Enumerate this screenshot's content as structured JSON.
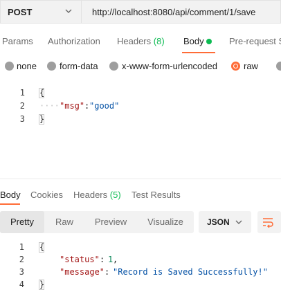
{
  "request": {
    "method": "POST",
    "url": "http://localhost:8080/api/comment/1/save"
  },
  "request_tabs": {
    "params": "Params",
    "authorization": "Authorization",
    "headers_label": "Headers",
    "headers_count": "(8)",
    "body": "Body",
    "pre_request": "Pre-request S"
  },
  "body_types": {
    "none": "none",
    "form_data": "form-data",
    "urlencoded": "x-www-form-urlencoded",
    "raw": "raw",
    "selected": "raw"
  },
  "request_body": {
    "line_numbers": [
      "1",
      "2",
      "3"
    ],
    "open_brace": "{",
    "key": "\"msg\"",
    "colon": ":",
    "value": "\"good\"",
    "close_brace": "}"
  },
  "response_tabs": {
    "body": "Body",
    "cookies": "Cookies",
    "headers_label": "Headers",
    "headers_count": "(5)",
    "test_results": "Test Results"
  },
  "view_modes": {
    "pretty": "Pretty",
    "raw": "Raw",
    "preview": "Preview",
    "visualize": "Visualize",
    "selected": "Pretty"
  },
  "format_select": {
    "value": "JSON"
  },
  "response_body": {
    "line_numbers": [
      "1",
      "2",
      "3",
      "4"
    ],
    "open_brace": "{",
    "status_key": "\"status\"",
    "status_value": "1",
    "message_key": "\"message\"",
    "message_value": "\"Record is Saved Successfully!\"",
    "close_brace": "}"
  },
  "icons": {
    "method_dropdown": "chevron-down-icon",
    "format_dropdown": "chevron-down-icon",
    "wrap": "wrap-lines-icon"
  },
  "colors": {
    "accent": "#ff6c37",
    "count_green": "#0cbb52",
    "json_key": "#a31515",
    "json_string": "#0451a5",
    "json_number": "#098658"
  }
}
